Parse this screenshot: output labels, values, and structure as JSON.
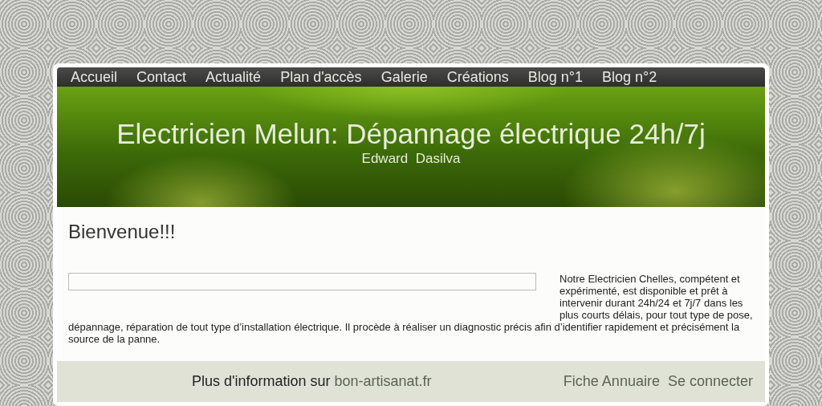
{
  "nav": [
    {
      "label": "Accueil"
    },
    {
      "label": "Contact"
    },
    {
      "label": "Actualité"
    },
    {
      "label": "Plan d'accès"
    },
    {
      "label": "Galerie"
    },
    {
      "label": "Créations"
    },
    {
      "label": "Blog n°1"
    },
    {
      "label": "Blog n°2"
    }
  ],
  "header": {
    "title": "Electricien Melun: Dépannage électrique 24h/7j",
    "subtitle": "Edward  Dasilva"
  },
  "content": {
    "heading": "Bienvenue!!!",
    "paragraph_lines": [
      "Notre Electricien Chelles, compétent et expérimenté, est disponible et prêt à intervenir durant 24h/24 et 7j/7 dans les plus courts délais, pour tout type de pose,",
      "dépannage, réparation de tout type d’installation électrique. Il procède à réaliser un diagnostic précis afin d’identifier rapidement et précisément la source de la panne."
    ]
  },
  "footer": {
    "info_text": "Plus d'information sur",
    "info_link": "bon-artisanat.fr",
    "links": [
      {
        "label": "Fiche Annuaire"
      },
      {
        "label": "Se connecter"
      }
    ]
  }
}
